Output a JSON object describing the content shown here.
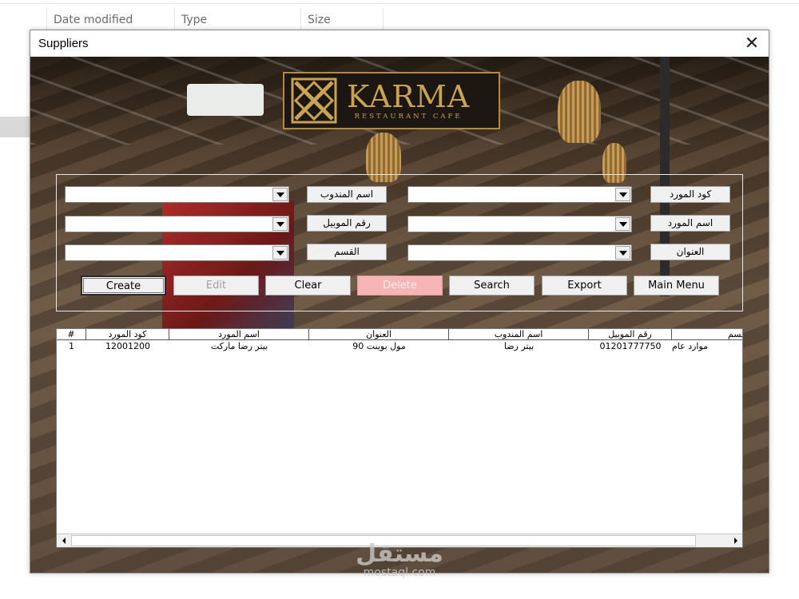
{
  "explorer": {
    "columns": [
      "Date modified",
      "Type",
      "Size"
    ]
  },
  "dialog": {
    "title": "Suppliers",
    "close_icon": "close-icon"
  },
  "logo": {
    "name": "KARMA",
    "subtitle": "RESTAURANT CAFE",
    "colors": {
      "gold": "#c9a253",
      "background": "#1c1713"
    }
  },
  "form": {
    "labels": {
      "supplier_code": "كود المورد",
      "supplier_name": "اسم المورد",
      "address": "العنوان",
      "rep_name": "اسم المندوب",
      "mobile": "رقم الموبيل",
      "department": "القسم"
    },
    "fields": {
      "supplier_code": "",
      "supplier_name": "",
      "address": "",
      "rep_name": "",
      "mobile": "",
      "department": ""
    }
  },
  "buttons": {
    "create": "Create",
    "edit": "Edit",
    "clear": "Clear",
    "delete": "Delete",
    "search": "Search",
    "export": "Export",
    "main_menu": "Main Menu"
  },
  "table": {
    "headers": [
      "#",
      "كود المورد",
      "اسم المورد",
      "العنوان",
      "اسم المندوب",
      "رقم الموبيل",
      "القسم"
    ],
    "rows": [
      [
        "1",
        "12001200",
        "بيتر رضا ماركت",
        "مول بوينت 90",
        "بيتر رضا",
        "01201777750",
        "موارد عام"
      ]
    ]
  },
  "watermark": {
    "arabic": "مستقل",
    "english": "mostaql.com"
  }
}
